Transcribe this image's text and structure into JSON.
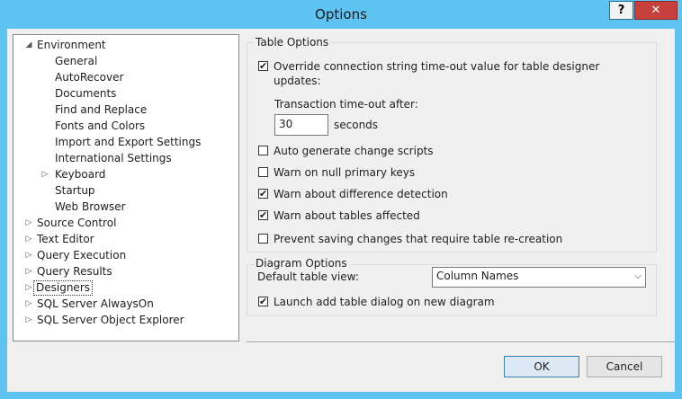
{
  "window": {
    "title": "Options",
    "help_label": "?",
    "close_label": "✕"
  },
  "tree": {
    "items": [
      {
        "label": "Environment",
        "expander": "◢"
      },
      {
        "label": "General"
      },
      {
        "label": "AutoRecover"
      },
      {
        "label": "Documents"
      },
      {
        "label": "Find and Replace"
      },
      {
        "label": "Fonts and Colors"
      },
      {
        "label": "Import and Export Settings"
      },
      {
        "label": "International Settings"
      },
      {
        "label": "Keyboard",
        "expander": "▷"
      },
      {
        "label": "Startup"
      },
      {
        "label": "Web Browser"
      },
      {
        "label": "Source Control",
        "expander": "▷"
      },
      {
        "label": "Text Editor",
        "expander": "▷"
      },
      {
        "label": "Query Execution",
        "expander": "▷"
      },
      {
        "label": "Query Results",
        "expander": "▷"
      },
      {
        "label": "Designers",
        "expander": "▷",
        "selected": true
      },
      {
        "label": "SQL Server AlwaysOn",
        "expander": "▷"
      },
      {
        "label": "SQL Server Object Explorer",
        "expander": "▷"
      }
    ]
  },
  "table_options": {
    "title": "Table Options",
    "override_timeout": {
      "label_line1": "Override connection string time-out value for table designer",
      "label_line2": "updates:",
      "checked": true
    },
    "transaction_timeout_label": "Transaction time-out after:",
    "timeout_value": "30",
    "seconds_label": "seconds",
    "checks": [
      {
        "label": "Auto generate change scripts",
        "checked": false
      },
      {
        "label": "Warn on null primary keys",
        "checked": false
      },
      {
        "label": "Warn about difference detection",
        "checked": true
      },
      {
        "label": "Warn about tables affected",
        "checked": true
      },
      {
        "label": "Prevent saving changes that require table re-creation",
        "checked": false
      }
    ]
  },
  "diagram_options": {
    "title": "Diagram Options",
    "default_view_label": "Default table view:",
    "default_view_value": "Column Names",
    "launch_add_table": {
      "label": "Launch add table dialog on new diagram",
      "checked": true
    }
  },
  "buttons": {
    "ok": "OK",
    "cancel": "Cancel"
  },
  "check_glyph": "✔"
}
